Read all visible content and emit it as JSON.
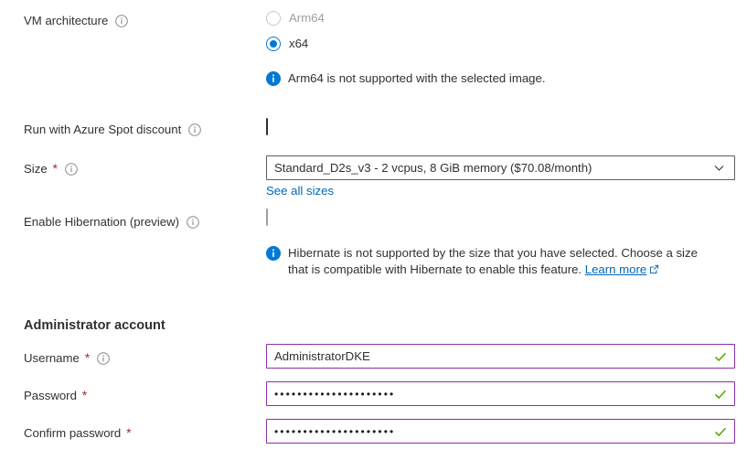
{
  "vm_architecture": {
    "label": "VM architecture",
    "info_icon": "info-circle-icon",
    "options": [
      {
        "label": "Arm64",
        "selected": false,
        "disabled": true
      },
      {
        "label": "x64",
        "selected": true,
        "disabled": false
      }
    ],
    "message": "Arm64 is not supported with the selected image.",
    "message_icon": "info-filled-icon"
  },
  "spot": {
    "label": "Run with Azure Spot discount",
    "info_icon": "info-circle-icon",
    "checked": false
  },
  "size": {
    "label": "Size",
    "required_marker": "*",
    "info_icon": "info-circle-icon",
    "value": "Standard_D2s_v3 - 2 vcpus, 8 GiB memory ($70.08/month)",
    "chevron_icon": "chevron-down-icon",
    "link_label": "See all sizes"
  },
  "hibernation": {
    "label": "Enable Hibernation (preview)",
    "info_icon": "info-circle-icon",
    "checked": false,
    "disabled": true,
    "message_icon": "info-filled-icon",
    "message_line1": "Hibernate is not supported by the size that you have selected. Choose a size",
    "message_line2": "that is compatible with Hibernate to enable this feature.",
    "message_link": "Learn more",
    "external_icon": "external-link-icon"
  },
  "administrator_account": {
    "heading": "Administrator account",
    "username": {
      "label": "Username",
      "required_marker": "*",
      "info_icon": "info-circle-icon",
      "value": "AdministratorDKE",
      "valid_icon": "checkmark-icon"
    },
    "password": {
      "label": "Password",
      "required_marker": "*",
      "value": "•••••••••••••••••••••",
      "valid_icon": "checkmark-icon"
    },
    "confirm_password": {
      "label": "Confirm password",
      "required_marker": "*",
      "value": "•••••••••••••••••••••",
      "valid_icon": "checkmark-icon"
    }
  },
  "colors": {
    "accent": "#0078d4",
    "link": "#0067b8",
    "required": "#a4262c",
    "valid_border": "#8c2fa8",
    "valid_check": "#57a300"
  }
}
